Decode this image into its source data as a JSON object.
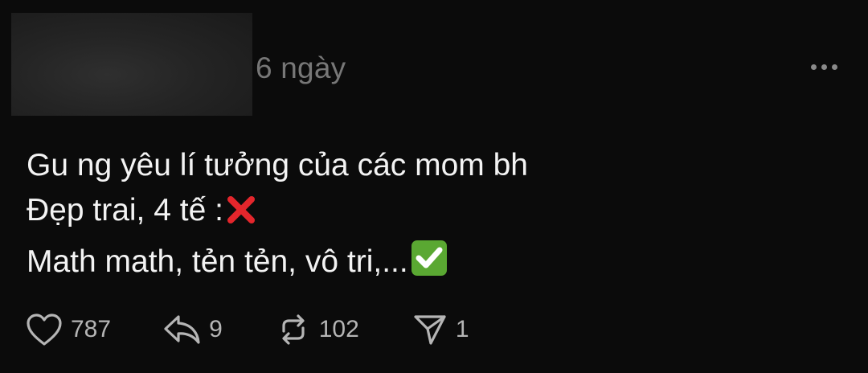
{
  "post": {
    "timestamp": "6 ngày",
    "lines": [
      "Gu ng yêu lí tưởng của các mom bh",
      "Đẹp trai, 4 tế :",
      "Math math, tẻn tẻn, vô tri,..."
    ],
    "emojis": [
      "cross-mark-icon",
      "check-mark-button-icon"
    ]
  },
  "actions": {
    "likes": "787",
    "replies": "9",
    "reposts": "102",
    "shares": "1"
  },
  "colors": {
    "background": "#0b0b0b",
    "text": "#f3f3f3",
    "muted": "#777777",
    "cross_red": "#e4262c",
    "check_green": "#5aa832"
  }
}
